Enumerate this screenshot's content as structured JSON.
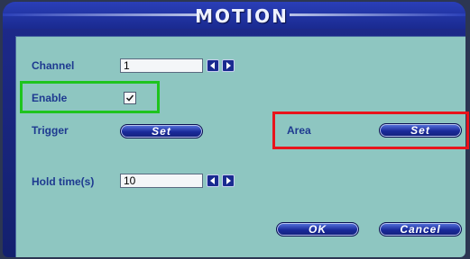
{
  "window": {
    "title": "MOTION"
  },
  "channel": {
    "label": "Channel",
    "value": "1"
  },
  "enable": {
    "label": "Enable",
    "checked": true
  },
  "trigger": {
    "label": "Trigger",
    "button": "Set"
  },
  "area": {
    "label": "Area",
    "button": "Set"
  },
  "hold_time": {
    "label": "Hold time(s)",
    "value": "10"
  },
  "footer": {
    "ok": "OK",
    "cancel": "Cancel"
  },
  "icons": {
    "prev": "arrow-left-icon",
    "next": "arrow-right-icon",
    "check": "checkmark-icon"
  },
  "highlights": {
    "enable": "#1ec41e",
    "area": "#e8141c"
  }
}
